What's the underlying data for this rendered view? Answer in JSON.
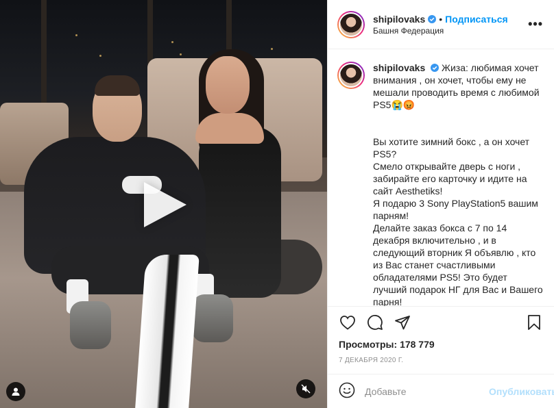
{
  "post": {
    "username": "shipilovaks",
    "follow_label": "Подписаться",
    "location": "Башня Федерация",
    "more_label": "•••"
  },
  "caption": {
    "username": "shipilovaks",
    "lines": [
      "Жиза: любимая хочет внимания , он хочет, чтобы ему не мешали проводить время с любимой PS5😭😡",
      "",
      "Вы хотите зимний бокс , а он хочет PS5?",
      "Смело открывайте дверь с ноги , забирайте его карточку и идите на сайт Aesthetiks!",
      "Я подарю 3 Sony PlayStation5 вашим парням!",
      "Делайте заказ бокса с 7 по 14 декабря включительно , и в следующий вторник Я объявлю , кто из Вас станет счастливыми обладателями PS5! Это будет лучший подарок НГ для Вас и Вашего парня!"
    ]
  },
  "stats": {
    "views_label": "Просмотры:",
    "views_value": "178 779",
    "date": "7 декабря 2020 г."
  },
  "comment": {
    "placeholder": "Добавьте",
    "publish_label": "Опубликовать"
  },
  "icons": {
    "like": "heart-icon",
    "comment": "comment-icon",
    "share": "share-icon",
    "save": "bookmark-icon",
    "play": "play-icon",
    "user_tag": "user-icon",
    "mute": "mute-icon",
    "emoji": "emoji-icon"
  },
  "colors": {
    "accent": "#0095f6",
    "publish_disabled": "#b2dffc",
    "secondary_text": "#8e8e8e"
  }
}
